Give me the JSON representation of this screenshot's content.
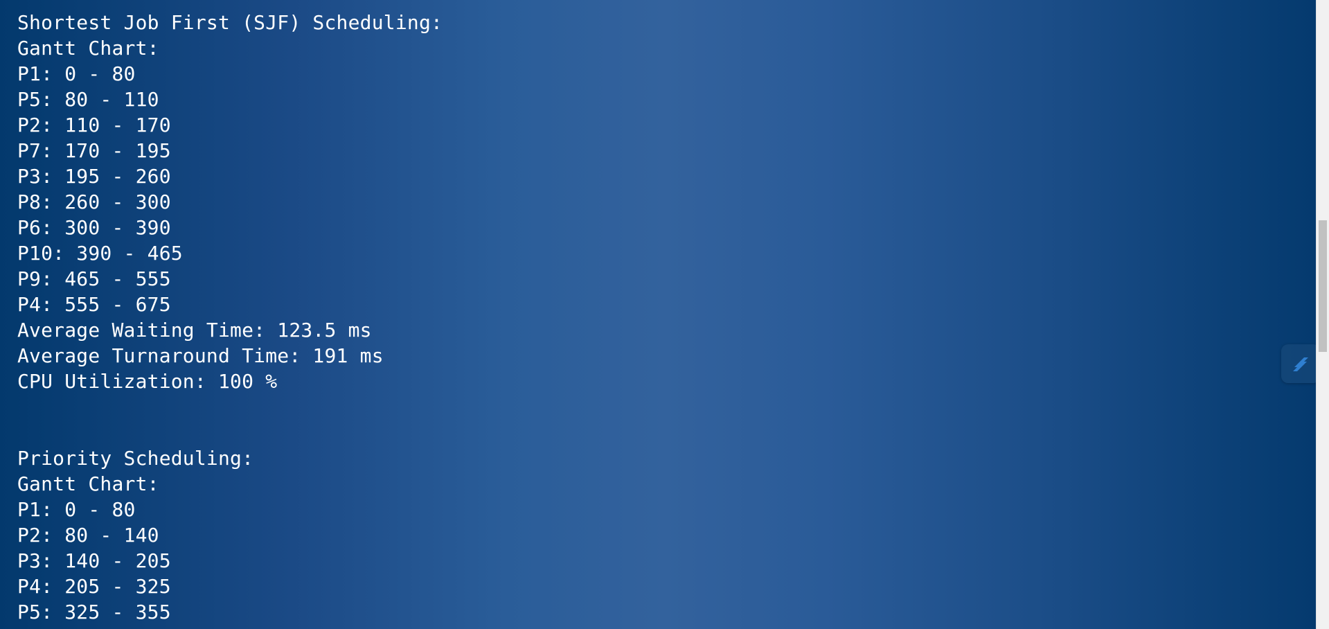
{
  "lines": [
    "Shortest Job First (SJF) Scheduling:",
    "Gantt Chart:",
    "P1: 0 - 80",
    "P5: 80 - 110",
    "P2: 110 - 170",
    "P7: 170 - 195",
    "P3: 195 - 260",
    "P8: 260 - 300",
    "P6: 300 - 390",
    "P10: 390 - 465",
    "P9: 465 - 555",
    "P4: 555 - 675",
    "Average Waiting Time: 123.5 ms",
    "Average Turnaround Time: 191 ms",
    "CPU Utilization: 100 %",
    "",
    "",
    "Priority Scheduling:",
    "Gantt Chart:",
    "P1: 0 - 80",
    "P2: 80 - 140",
    "P3: 140 - 205",
    "P4: 205 - 325",
    "P5: 325 - 355"
  ],
  "widget": {
    "icon": "slash-logo-icon",
    "color": "#2f7fd0"
  }
}
